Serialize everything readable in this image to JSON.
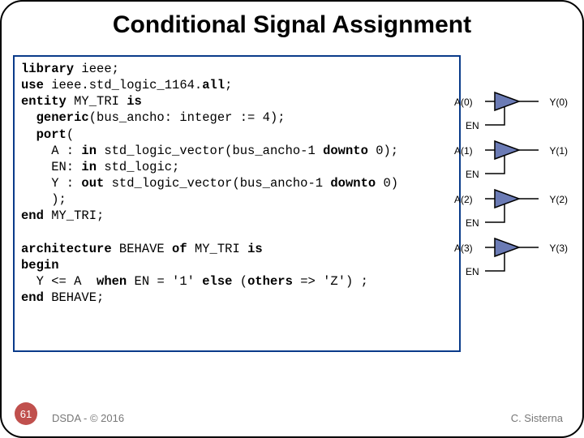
{
  "title": "Conditional Signal Assignment",
  "code": {
    "l1a": "library",
    "l1b": " ieee;",
    "l2a": "use",
    "l2b": " ieee.std_logic_1164.",
    "l2c": "all",
    "l2d": ";",
    "l3a": "entity",
    "l3b": " MY_TRI ",
    "l3c": "is",
    "l4a": "  generic",
    "l4b": "(bus_ancho: integer := 4);",
    "l5a": "  port",
    "l5b": "(",
    "l6a": "    A : ",
    "l6b": "in",
    "l6c": " std_logic_vector(bus_ancho-1 ",
    "l6d": "downto",
    "l6e": " 0);",
    "l7a": "    EN: ",
    "l7b": "in",
    "l7c": " std_logic;",
    "l8a": "    Y : ",
    "l8b": "out",
    "l8c": " std_logic_vector(bus_ancho-1 ",
    "l8d": "downto",
    "l8e": " 0)",
    "l9": "    );",
    "l10a": "end",
    "l10b": " MY_TRI;",
    "blank": "",
    "l11a": "architecture",
    "l11b": " BEHAVE ",
    "l11c": "of",
    "l11d": " MY_TRI ",
    "l11e": "is",
    "l12a": "begin",
    "l13a": "  Y <= A  ",
    "l13b": "when",
    "l13c": " EN = '1' ",
    "l13d": "else",
    "l13e": " (",
    "l13f": "others",
    "l13g": " => 'Z') ;",
    "l14a": "end",
    "l14b": " BEHAVE;"
  },
  "buffers": [
    {
      "a": "A(0)",
      "y": "Y(0)",
      "en": "EN"
    },
    {
      "a": "A(1)",
      "y": "Y(1)",
      "en": "EN"
    },
    {
      "a": "A(2)",
      "y": "Y(2)",
      "en": "EN"
    },
    {
      "a": "A(3)",
      "y": "Y(3)",
      "en": "EN"
    }
  ],
  "pagenum": "61",
  "footer_left": "DSDA - © 2016",
  "footer_right": "C. Sisterna"
}
